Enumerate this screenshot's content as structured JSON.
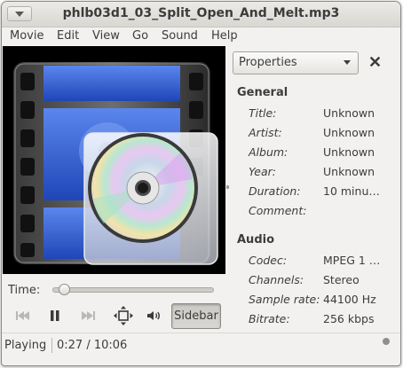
{
  "window": {
    "title": "phlb03d1_03_Split_Open_And_Melt.mp3"
  },
  "menubar": {
    "items": [
      {
        "label": "Movie"
      },
      {
        "label": "Edit"
      },
      {
        "label": "View"
      },
      {
        "label": "Go"
      },
      {
        "label": "Sound"
      },
      {
        "label": "Help"
      }
    ]
  },
  "sidebar": {
    "selector": {
      "label": "Properties"
    },
    "general": {
      "title": "General",
      "rows": [
        {
          "label": "Title:",
          "value": "Unknown"
        },
        {
          "label": "Artist:",
          "value": "Unknown"
        },
        {
          "label": "Album:",
          "value": "Unknown"
        },
        {
          "label": "Year:",
          "value": "Unknown"
        },
        {
          "label": "Duration:",
          "value": "10 minu…"
        },
        {
          "label": "Comment:",
          "value": ""
        }
      ]
    },
    "audio": {
      "title": "Audio",
      "rows": [
        {
          "label": "Codec:",
          "value": "MPEG 1 …"
        },
        {
          "label": "Channels:",
          "value": "Stereo"
        },
        {
          "label": "Sample rate:",
          "value": "44100 Hz"
        },
        {
          "label": "Bitrate:",
          "value": "256 kbps"
        }
      ]
    }
  },
  "controls": {
    "time_label": "Time:",
    "seek_fraction": 0.044,
    "sidebar_toggle_label": "Sidebar",
    "icons": [
      "skip-back-icon",
      "pause-icon",
      "skip-forward-icon",
      "fullscreen-icon",
      "volume-icon"
    ]
  },
  "statusbar": {
    "state": "Playing",
    "time": "0:27 / 10:06"
  },
  "colors": {
    "video_background": "#000000",
    "film_blue": "#2f5fd8",
    "window_background": "#f2f1f0"
  }
}
